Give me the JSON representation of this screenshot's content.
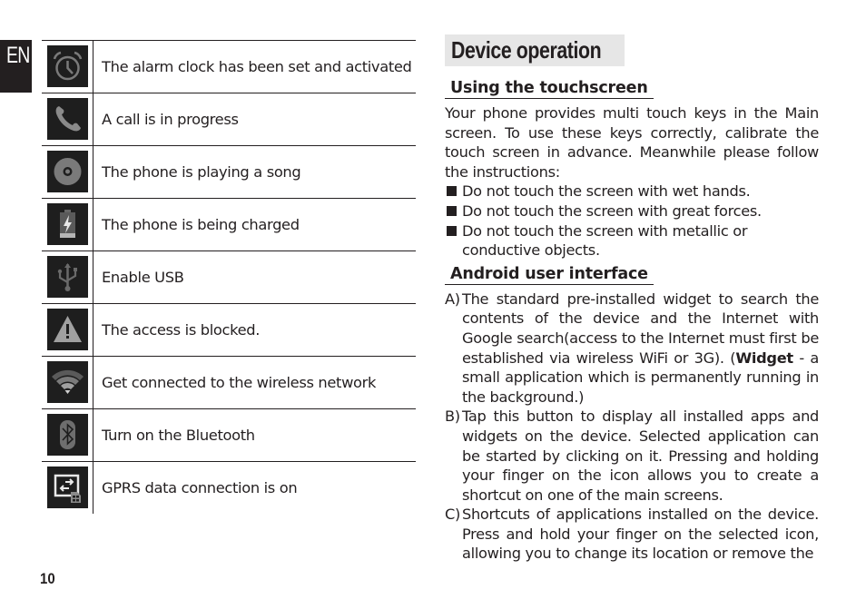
{
  "page": {
    "language_tab": "EN",
    "page_number": "10"
  },
  "icon_table": {
    "rows": [
      {
        "icon": "alarm-clock-icon",
        "description": "The alarm clock has been set and activated"
      },
      {
        "icon": "phone-call-icon",
        "description": "A call is in progress"
      },
      {
        "icon": "music-disc-icon",
        "description": "The phone is playing a song"
      },
      {
        "icon": "battery-charging-icon",
        "description": "The phone is being charged"
      },
      {
        "icon": "usb-icon",
        "description": "Enable USB"
      },
      {
        "icon": "warning-icon",
        "description": "The access is blocked."
      },
      {
        "icon": "wifi-icon",
        "description": "Get connected to the wireless network"
      },
      {
        "icon": "bluetooth-icon",
        "description": "Turn on the Bluetooth"
      },
      {
        "icon": "gprs-data-icon",
        "description": "GPRS data connection is on"
      }
    ]
  },
  "content": {
    "section_title": "Device operation",
    "touchscreen": {
      "heading": "Using the touchscreen",
      "intro": "Your phone provides multi touch keys in the Main screen. To use these keys correctly, calibrate the touch screen in advance. Meanwhile please follow the instructions:",
      "bullets": [
        "Do not touch the screen with wet hands.",
        "Do not touch the screen with great forces.",
        "Do not touch the screen with metallic or conductive objects."
      ]
    },
    "android_ui": {
      "heading": "Android user interface",
      "items": [
        {
          "letter": "A)",
          "text_before": "The standard pre-installed widget to search the contents of the device and the Internet with Google search(access to the Internet must first be established via wireless WiFi or 3G). (",
          "bold": "Widget",
          "text_after": " - a small application which is permanently running in the background.)"
        },
        {
          "letter": "B)",
          "text_before": "Tap this button to display all installed apps and widgets on the device. Selected application can be started by clicking on it. Pressing and holding your finger on the icon allows you to create a shortcut on one of the main screens.",
          "bold": "",
          "text_after": ""
        },
        {
          "letter": "C)",
          "text_before": "Shortcuts of applications installed on the device. Press and hold your finger on the selected icon, allowing you to change its location or remove the",
          "bold": "",
          "text_after": ""
        }
      ]
    }
  },
  "colors": {
    "text": "#231f20",
    "icon_background": "#1e1e1e",
    "icon_glyph": "#8a8a8a",
    "title_box": "#e6e6e6"
  }
}
